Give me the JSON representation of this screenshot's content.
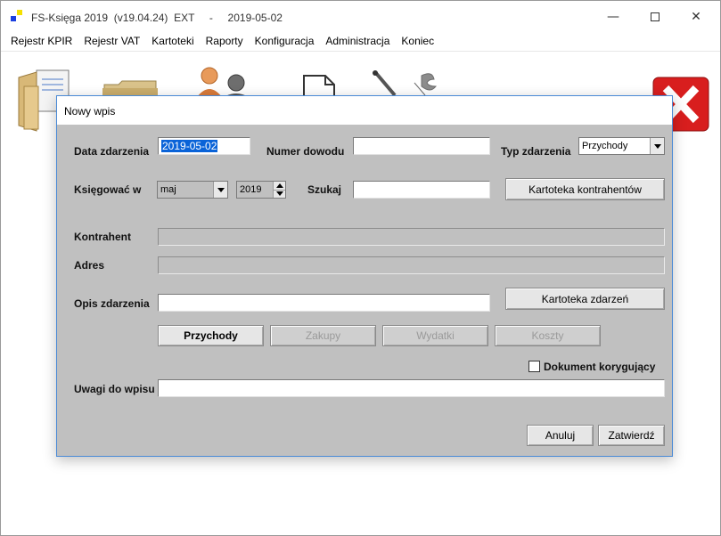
{
  "window": {
    "title": "FS-Księga 2019  (v19.04.24)  EXT     -     2019-05-02",
    "controls": {
      "minimize": "—",
      "close": "✕"
    }
  },
  "menu": [
    "Rejestr KPIR",
    "Rejestr VAT",
    "Kartoteki",
    "Raporty",
    "Konfiguracja",
    "Administracja",
    "Koniec"
  ],
  "toolbar_icons": [
    "documents-icon",
    "folder-icon",
    "users-icon",
    "document-icon",
    "tools-icon",
    "exit-icon"
  ],
  "dialog": {
    "title": "Nowy wpis",
    "labels": {
      "date": "Data zdarzenia",
      "proof_number": "Numer dowodu",
      "event_type": "Typ zdarzenia",
      "book_in": "Księgować w",
      "search": "Szukaj",
      "contractor": "Kontrahent",
      "address": "Adres",
      "description": "Opis zdarzenia",
      "remarks": "Uwagi do wpisu",
      "correcting_document": "Dokument korygujący"
    },
    "values": {
      "date": "2019-05-02",
      "proof_number": "",
      "event_type": "Przychody",
      "month": "maj",
      "year": "2019",
      "search": "",
      "contractor": "",
      "address": "",
      "description": "",
      "remarks": "",
      "correcting_document_checked": false
    },
    "buttons": {
      "contractors_card": "Kartoteka  kontrahentów",
      "events_card": "Kartoteka zdarzeń",
      "income": "Przychody",
      "purchases": "Zakupy",
      "expenses": "Wydatki",
      "costs": "Koszty",
      "cancel": "Anuluj",
      "confirm": "Zatwierdź"
    }
  },
  "colors": {
    "dialog_bg": "#c0c0c0",
    "selection": "#0a63d8",
    "dialog_border": "#4a8ad6",
    "exit_red": "#d81e1e"
  }
}
